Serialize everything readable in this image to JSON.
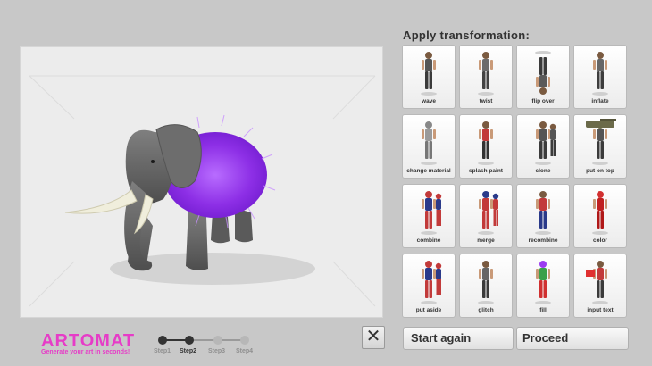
{
  "panel": {
    "title": "Apply transformation:"
  },
  "transformations": [
    {
      "label": "wave",
      "icon": "figure-wave-icon"
    },
    {
      "label": "twist",
      "icon": "figure-twist-icon"
    },
    {
      "label": "flip over",
      "icon": "figure-flip-icon"
    },
    {
      "label": "inflate",
      "icon": "figure-inflate-icon"
    },
    {
      "label": "change material",
      "icon": "figure-material-icon"
    },
    {
      "label": "splash paint",
      "icon": "figure-paint-icon"
    },
    {
      "label": "clone",
      "icon": "figure-clone-icon"
    },
    {
      "label": "put on top",
      "icon": "figure-tank-icon"
    },
    {
      "label": "combine",
      "icon": "figure-combine-icon"
    },
    {
      "label": "merge",
      "icon": "figure-merge-icon"
    },
    {
      "label": "recombine",
      "icon": "figure-recombine-icon"
    },
    {
      "label": "color",
      "icon": "figure-color-icon"
    },
    {
      "label": "put aside",
      "icon": "figure-aside-icon"
    },
    {
      "label": "glitch",
      "icon": "figure-glitch-icon"
    },
    {
      "label": "fill",
      "icon": "figure-fill-icon"
    },
    {
      "label": "input text",
      "icon": "figure-text-icon"
    }
  ],
  "brand": {
    "name": "ARTOMAT",
    "tagline": "Generate your art in seconds!",
    "color": "#e63cc7"
  },
  "steps": {
    "labels": [
      "Step1",
      "Step2",
      "Step3",
      "Step4"
    ],
    "current": 2
  },
  "buttons": {
    "close": "✕",
    "start_again": "Start again",
    "proceed": "Proceed"
  },
  "preview": {
    "subject": "elephant with purple fur",
    "fur_color": "#9b3cf0"
  }
}
